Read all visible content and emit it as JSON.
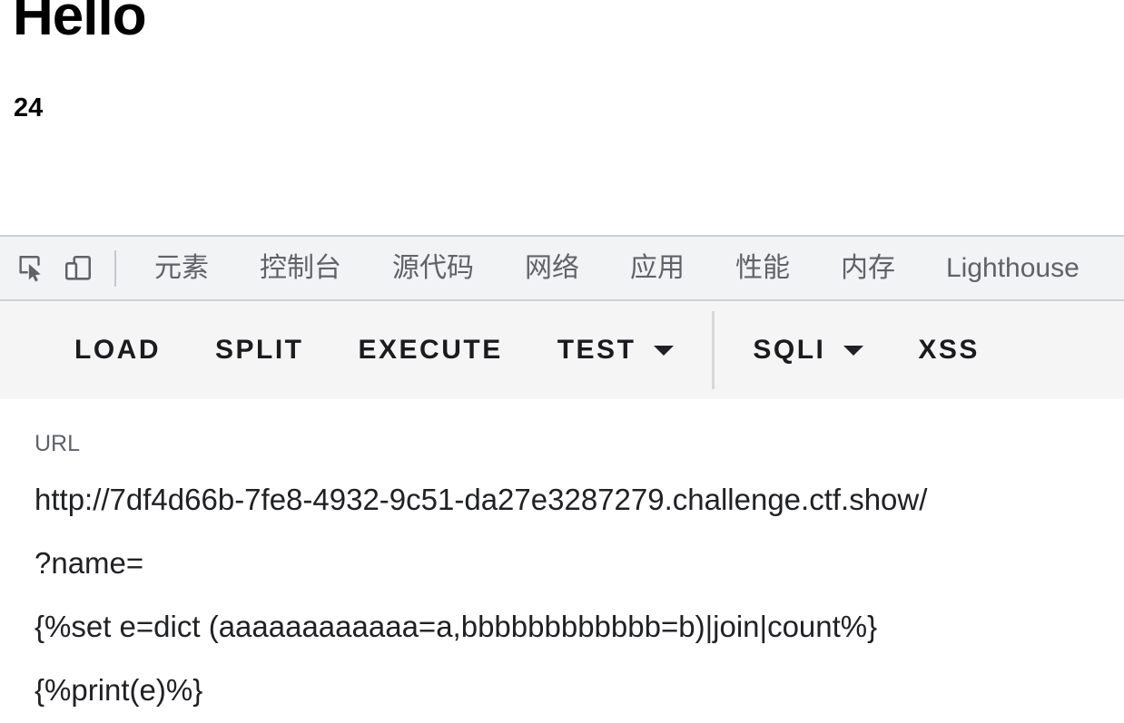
{
  "page": {
    "heading": "Hello",
    "subheading": "24"
  },
  "devtools": {
    "icons": {
      "inspect": "inspect-element-icon",
      "device": "device-toolbar-icon"
    },
    "tabs": [
      {
        "label": "元素"
      },
      {
        "label": "控制台"
      },
      {
        "label": "源代码"
      },
      {
        "label": "网络"
      },
      {
        "label": "应用"
      },
      {
        "label": "性能"
      },
      {
        "label": "内存"
      },
      {
        "label": "Lighthouse"
      }
    ],
    "toolbar": {
      "load_label": "LOAD",
      "split_label": "SPLIT",
      "execute_label": "EXECUTE",
      "test_label": "TEST",
      "sqli_label": "SQLI",
      "xss_label": "XSS"
    },
    "request": {
      "url_label": "URL",
      "url_line": "http://7df4d66b-7fe8-4932-9c51-da27e3287279.challenge.ctf.show/",
      "query_line": "?name=",
      "payload_line_1": "{%set e=dict (aaaaaaaaaaaa=a,bbbbbbbbbbbb=b)|join|count%}",
      "payload_line_2": "{%print(e)%}"
    }
  },
  "colors": {
    "tabbar_bg": "#f1f3f4",
    "toolbar_bg": "#f5f5f5",
    "body_bg": "#ffffff",
    "tab_text": "#5f6368",
    "button_text": "#1b1b1f",
    "label_text": "#5f6368"
  }
}
